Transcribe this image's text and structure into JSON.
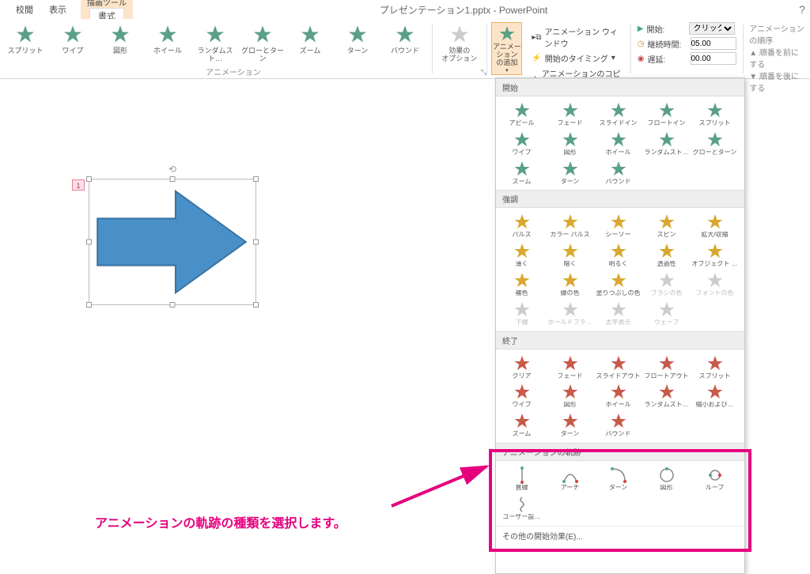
{
  "title_bar": {
    "tool_context": "描画ツール",
    "tool_tab": "書式",
    "doc_title": "プレゼンテーション1.pptx - PowerPoint",
    "tabs": [
      "校閲",
      "表示"
    ],
    "help": "?"
  },
  "ribbon": {
    "gallery": [
      {
        "label": "スプリット"
      },
      {
        "label": "ワイプ"
      },
      {
        "label": "図形"
      },
      {
        "label": "ホイール"
      },
      {
        "label": "ランダムスト…"
      },
      {
        "label": "グローとターン"
      },
      {
        "label": "ズーム"
      },
      {
        "label": "ターン"
      },
      {
        "label": "バウンド"
      }
    ],
    "group_label": "アニメーション",
    "effect_options": "効果の\nオプション",
    "add_animation": "アニメーション\nの追加",
    "anim_pane": "アニメーション ウィンドウ",
    "trigger": "開始のタイミング",
    "anim_painter": "アニメーションのコピー/貼り付け",
    "timing": {
      "start_label": "開始:",
      "start_value": "クリック時",
      "duration_label": "継続時間:",
      "duration_value": "05.00",
      "delay_label": "遅延:",
      "delay_value": "00.00"
    },
    "reorder": {
      "title": "アニメーションの順序",
      "earlier": "順番を前にする",
      "later": "順番を後にする"
    }
  },
  "slide": {
    "tag": "1"
  },
  "dropdown": {
    "sections": {
      "entrance": {
        "title": "開始",
        "items": [
          "アピール",
          "フェード",
          "スライドイン",
          "フロートイン",
          "スプリット",
          "ワイプ",
          "図形",
          "ホイール",
          "ランダムスト…",
          "グローとターン",
          "ズーム",
          "ターン",
          "バウンド"
        ]
      },
      "emphasis": {
        "title": "強調",
        "items": [
          "パルス",
          "カラー パルス",
          "シーソー",
          "スピン",
          "拡大/収縮",
          "薄く",
          "暗く",
          "明るく",
          "透過性",
          "オブジェクト …",
          "補色",
          "線の色",
          "塗りつぶしの色",
          "ブラシの色",
          "フォントの色",
          "下線",
          "ボールドフラ…",
          "太字表示",
          "ウェーブ"
        ],
        "disabled": [
          13,
          14,
          15,
          16,
          17,
          18
        ]
      },
      "exit": {
        "title": "終了",
        "items": [
          "クリア",
          "フェード",
          "スライドアウト",
          "フロートアウト",
          "スプリット",
          "ワイプ",
          "図形",
          "ホイール",
          "ランダムスト…",
          "縮小および…",
          "ズーム",
          "ターン",
          "バウンド"
        ]
      },
      "motion": {
        "title": "アニメーションの軌跡",
        "items": [
          "直線",
          "アーチ",
          "ターン",
          "図形",
          "ループ",
          "ユーザー設…"
        ]
      }
    },
    "more1": "その他の開始効果(E)..."
  },
  "annotation": {
    "text": "アニメーションの軌跡の種類を選択します。"
  }
}
